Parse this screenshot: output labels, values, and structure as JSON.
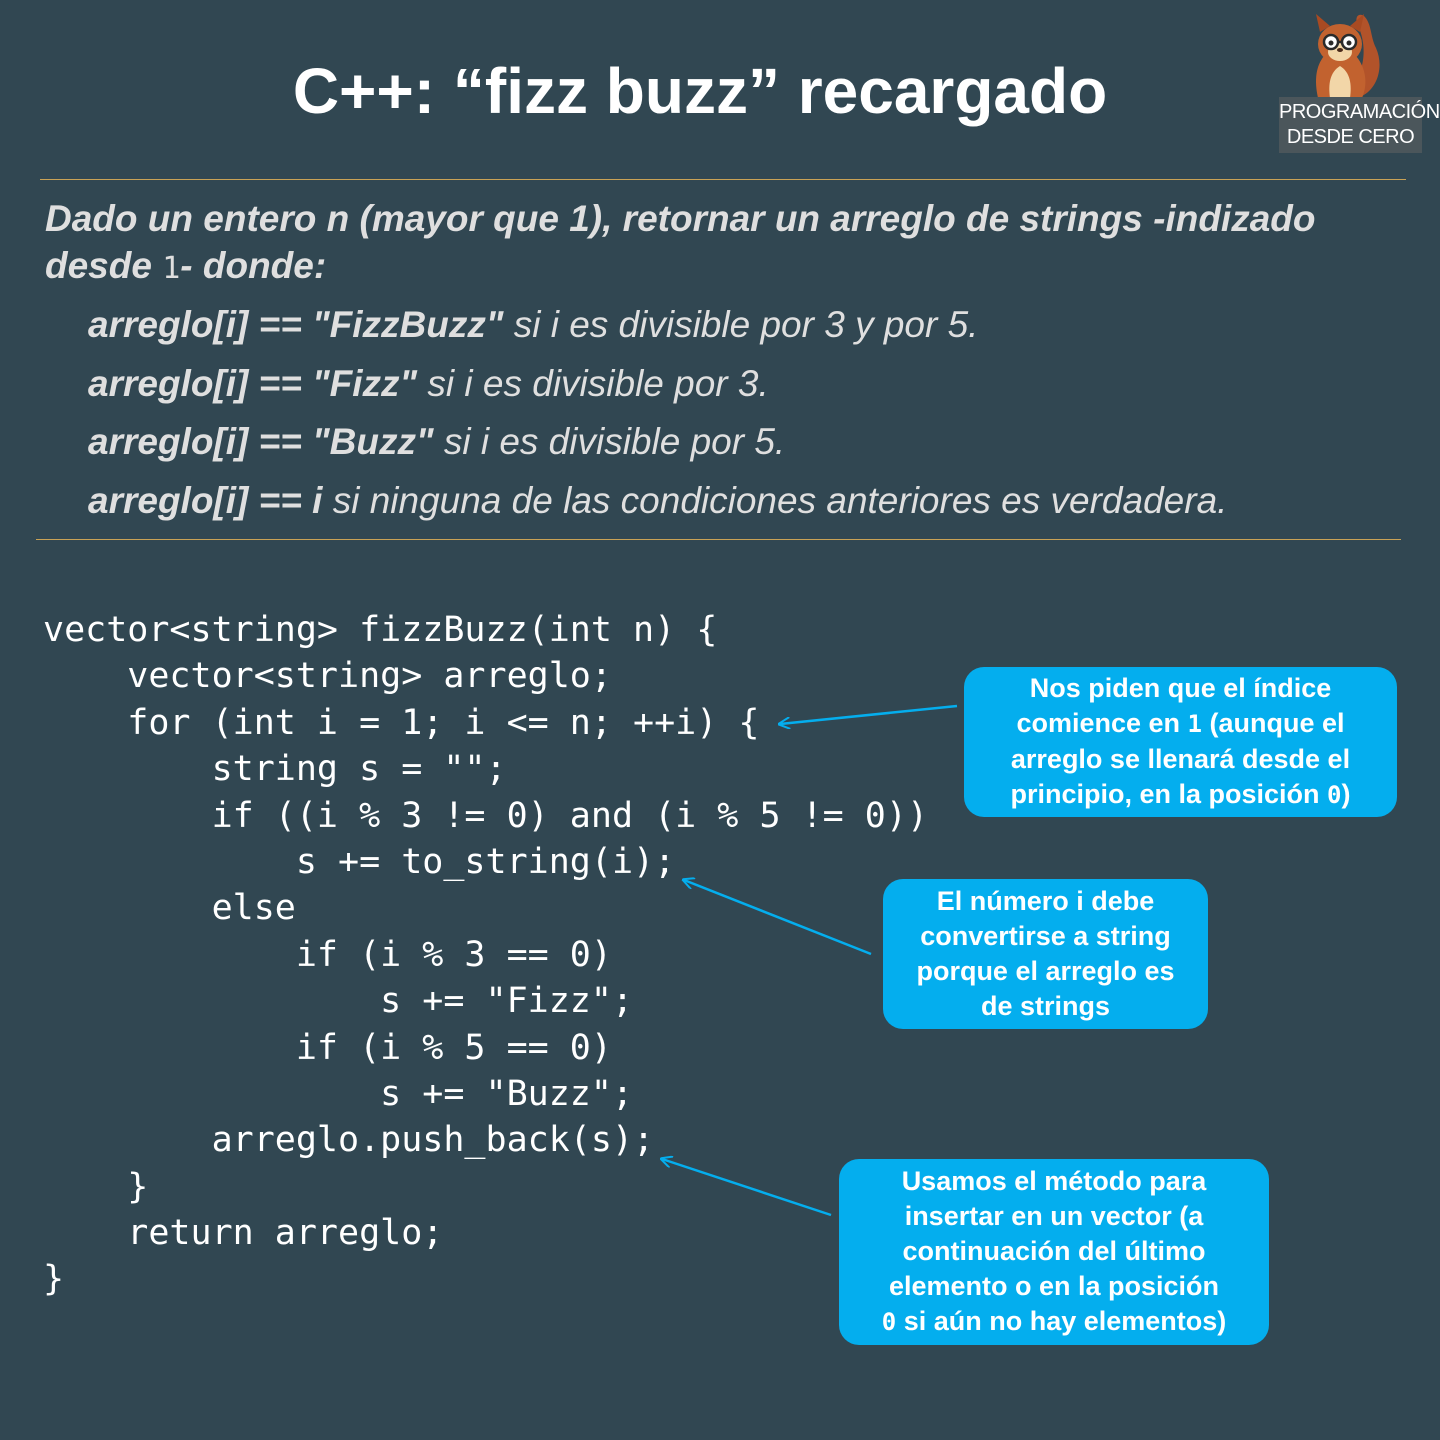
{
  "title": "C++: “fizz buzz” recargado",
  "logo": {
    "line1": "PROGRAMACIÓN",
    "line2": "DESDE CERO"
  },
  "statement": {
    "text_before": "Dado un entero n (mayor que 1), retornar un arreglo de strings -indizado desde",
    "number": "1",
    "text_after": "- donde:"
  },
  "rules": [
    {
      "expr": "arreglo[i] == \"FizzBuzz\"",
      "desc": " si i es divisible por 3 y por 5."
    },
    {
      "expr": "arreglo[i] == \"Fizz\"",
      "desc": " si i es divisible por 3."
    },
    {
      "expr": "arreglo[i] == \"Buzz\"",
      "desc": " si i es divisible por 5."
    },
    {
      "expr": "arreglo[i] == i",
      "desc": " si ninguna de las condiciones anteriores es verdadera."
    }
  ],
  "code": [
    "vector<string> fizzBuzz(int n) {",
    "    vector<string> arreglo;",
    "    for (int i = 1; i <= n; ++i) {",
    "        string s = \"\";",
    "        if ((i % 3 != 0) and (i % 5 != 0))",
    "            s += to_string(i);",
    "        else",
    "            if (i % 3 == 0)",
    "                s += \"Fizz\";",
    "            if (i % 5 == 0)",
    "                s += \"Buzz\";",
    "        arreglo.push_back(s);",
    "    }",
    "    return arreglo;",
    "}"
  ],
  "callouts": {
    "index": {
      "line1": "Nos piden que el índice",
      "line2_before": "comience en",
      "line2_number": "1",
      "line2_after": "(aunque el",
      "line3": "arreglo se llenará desde el",
      "line4_before": "principio, en la posición",
      "line4_number": "0",
      "line4_after": ")"
    },
    "to_string": {
      "line1": "El número i debe",
      "line2": "convertirse a string",
      "line3": "porque el arreglo es",
      "line4": "de strings"
    },
    "push_back": {
      "line1": "Usamos el método para",
      "line2": "insertar en un vector (a",
      "line3": "continuación del último",
      "line4": "elemento o en la posición",
      "line5_number": "0",
      "line5_after": "si aún no hay elementos)"
    }
  },
  "colors": {
    "background": "#314752",
    "callout": "#04aeee",
    "rule": "#c9a256",
    "statement_text": "#dfdfdf"
  }
}
